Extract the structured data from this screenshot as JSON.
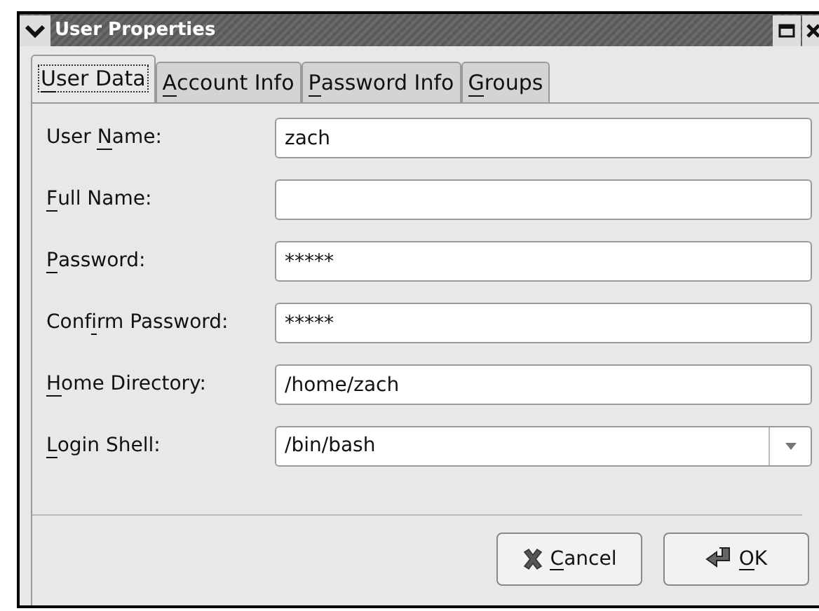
{
  "window": {
    "title": "User Properties"
  },
  "tabs": [
    {
      "label": {
        "key": "U",
        "after": "ser Data"
      },
      "selected": true
    },
    {
      "label": {
        "key": "A",
        "after": "ccount Info"
      },
      "selected": false
    },
    {
      "label": {
        "key": "P",
        "after": "assword Info"
      },
      "selected": false
    },
    {
      "label": {
        "key": "G",
        "after": "roups"
      },
      "selected": false
    }
  ],
  "fields": [
    {
      "label": {
        "before": "User ",
        "key": "N",
        "after": "ame:"
      },
      "kind": "text",
      "value": "zach"
    },
    {
      "label": {
        "key": "F",
        "after": "ull Name:"
      },
      "kind": "text"
    },
    {
      "label": {
        "key": "P",
        "after": "assword:"
      },
      "kind": "text",
      "value": "*****"
    },
    {
      "label": {
        "before": "Conf",
        "key": "i",
        "after": "rm Password:"
      },
      "kind": "text",
      "value": "*****"
    },
    {
      "label": {
        "key": "H",
        "after": "ome Directory:"
      },
      "kind": "text",
      "value": "/home/zach"
    },
    {
      "label": {
        "key": "L",
        "after": "ogin Shell:"
      },
      "kind": "combo",
      "value": "/bin/bash"
    }
  ],
  "buttons": [
    {
      "label": {
        "key": "C",
        "after": "ancel"
      },
      "kind": "cancel"
    },
    {
      "label": {
        "key": "O",
        "after": "K"
      },
      "kind": "ok"
    }
  ]
}
